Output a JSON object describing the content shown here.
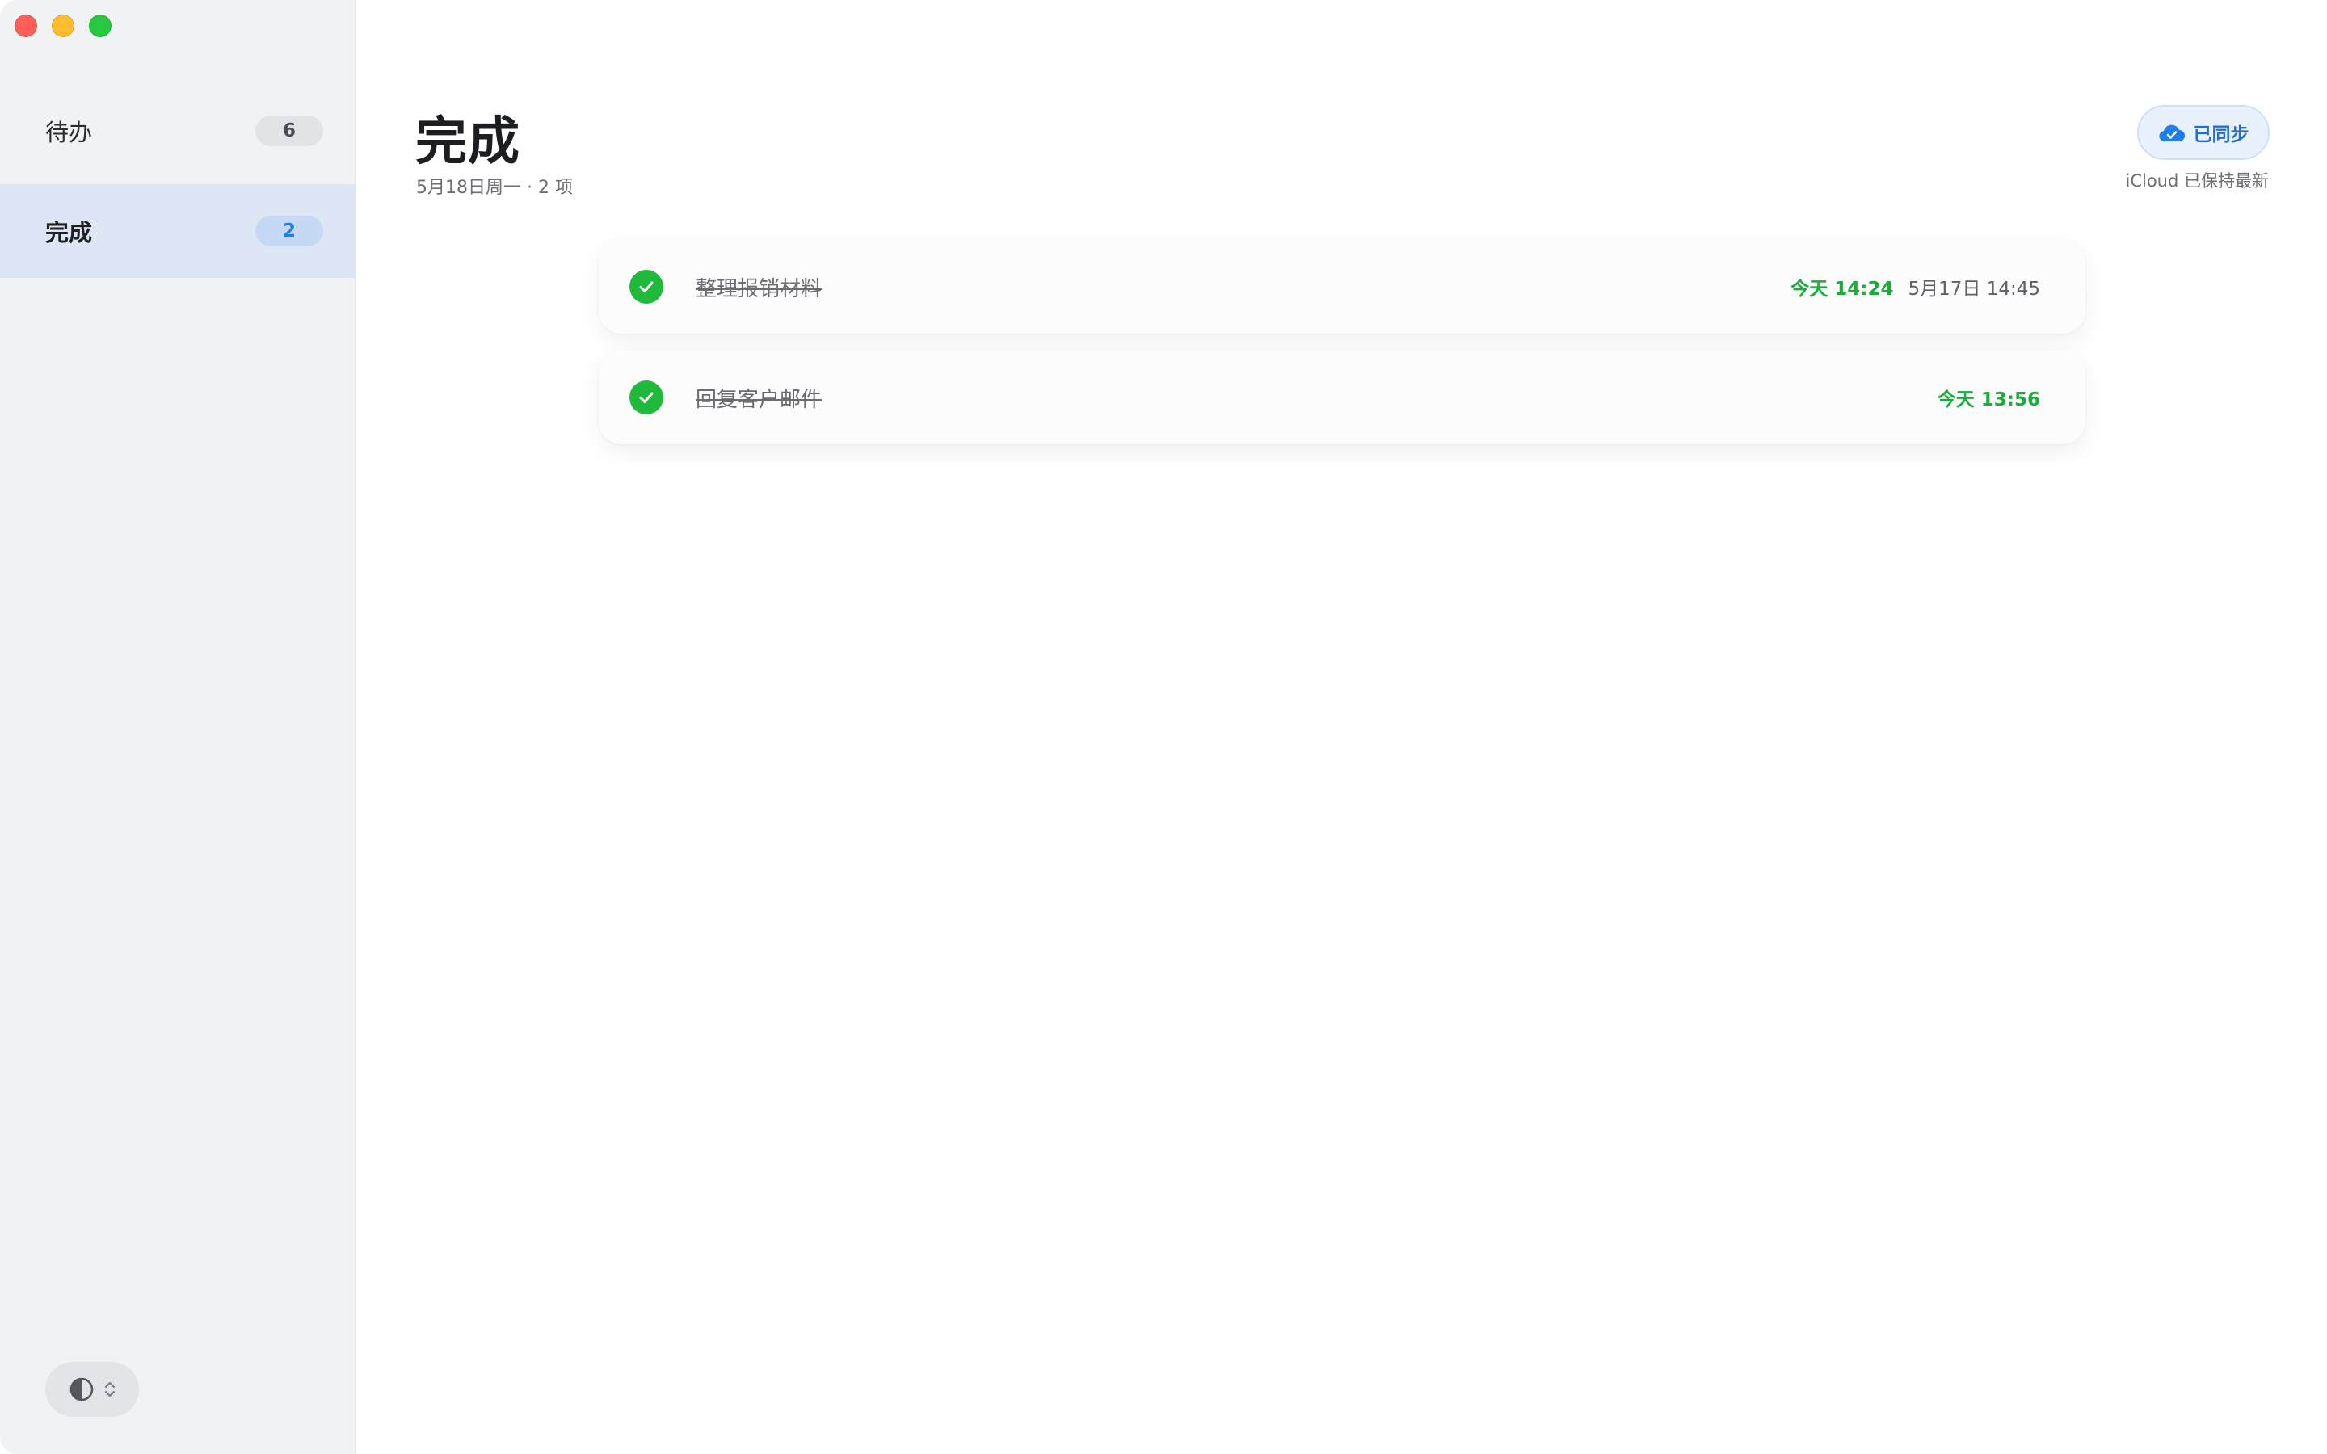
{
  "sidebar": {
    "items": [
      {
        "label": "待办",
        "count": "6"
      },
      {
        "label": "完成",
        "count": "2",
        "selected": true
      }
    ]
  },
  "header": {
    "title": "完成",
    "subtitle": "5月18日周一 · 2 项"
  },
  "sync": {
    "label": "已同步",
    "note": "iCloud 已保持最新"
  },
  "tasks": [
    {
      "title": "整理报销材料",
      "completed_time": "今天 14:24",
      "due_time": "5月17日 14:45"
    },
    {
      "title": "回复客户邮件",
      "completed_time": "今天 13:56"
    }
  ],
  "icons": {
    "close": "traffic-close-icon",
    "minimize": "traffic-minimize-icon",
    "zoom": "traffic-zoom-icon",
    "cloud": "cloud-check-icon",
    "check": "checkmark-icon",
    "theme": "half-circle-icon",
    "chevrons": "chevron-updown-icon"
  },
  "colors": {
    "accent": "#2a7be0",
    "success": "#1fba3c",
    "traffic_close": "#ff5f57",
    "traffic_minimize": "#febc2e",
    "traffic_zoom": "#28c840"
  }
}
